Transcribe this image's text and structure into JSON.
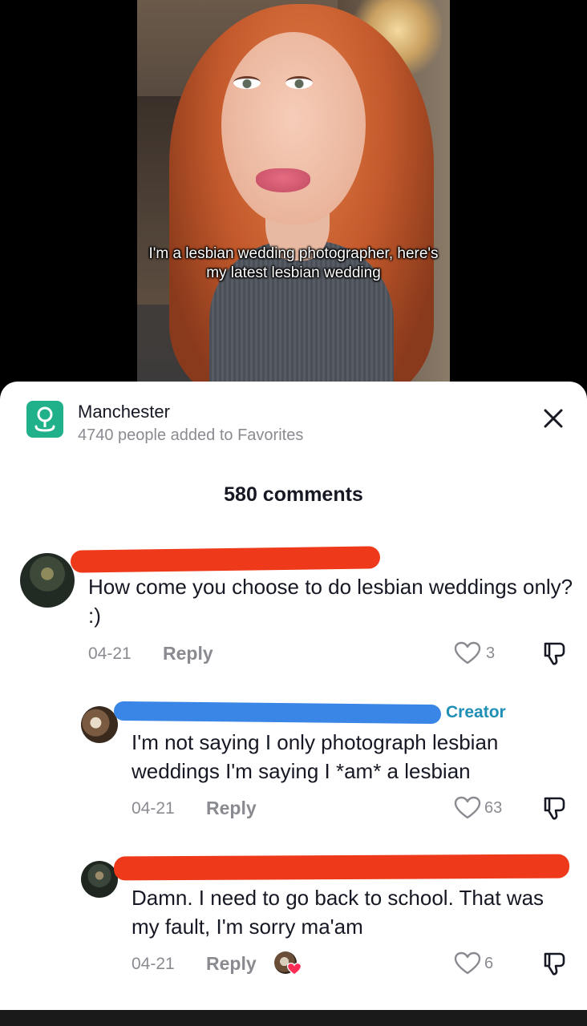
{
  "video": {
    "caption": "I'm a lesbian wedding photographer, here's my latest lesbian wedding"
  },
  "location": {
    "icon": "location-pin-icon",
    "title": "Manchester",
    "subtitle": "4740 people added to Favorites"
  },
  "comments_header": "580 comments",
  "comments": [
    {
      "text": "How come you choose to do lesbian weddings only? :)",
      "date": "04-21",
      "reply_label": "Reply",
      "likes": "3"
    },
    {
      "badge": "Creator",
      "text": "I'm not saying I only photograph lesbian weddings I'm saying I *am* a lesbian",
      "date": "04-21",
      "reply_label": "Reply",
      "likes": "63"
    },
    {
      "text": "Damn. I need to go back to school. That was my fault, I'm sorry ma'am",
      "date": "04-21",
      "reply_label": "Reply",
      "likes": "6"
    }
  ],
  "colors": {
    "location_icon": "#20b08a",
    "redaction_orange": "#ee3a1a",
    "redaction_blue": "#3a86e6",
    "creator_badge": "#1f8fb5",
    "liked_heart": "#ff2d55"
  }
}
